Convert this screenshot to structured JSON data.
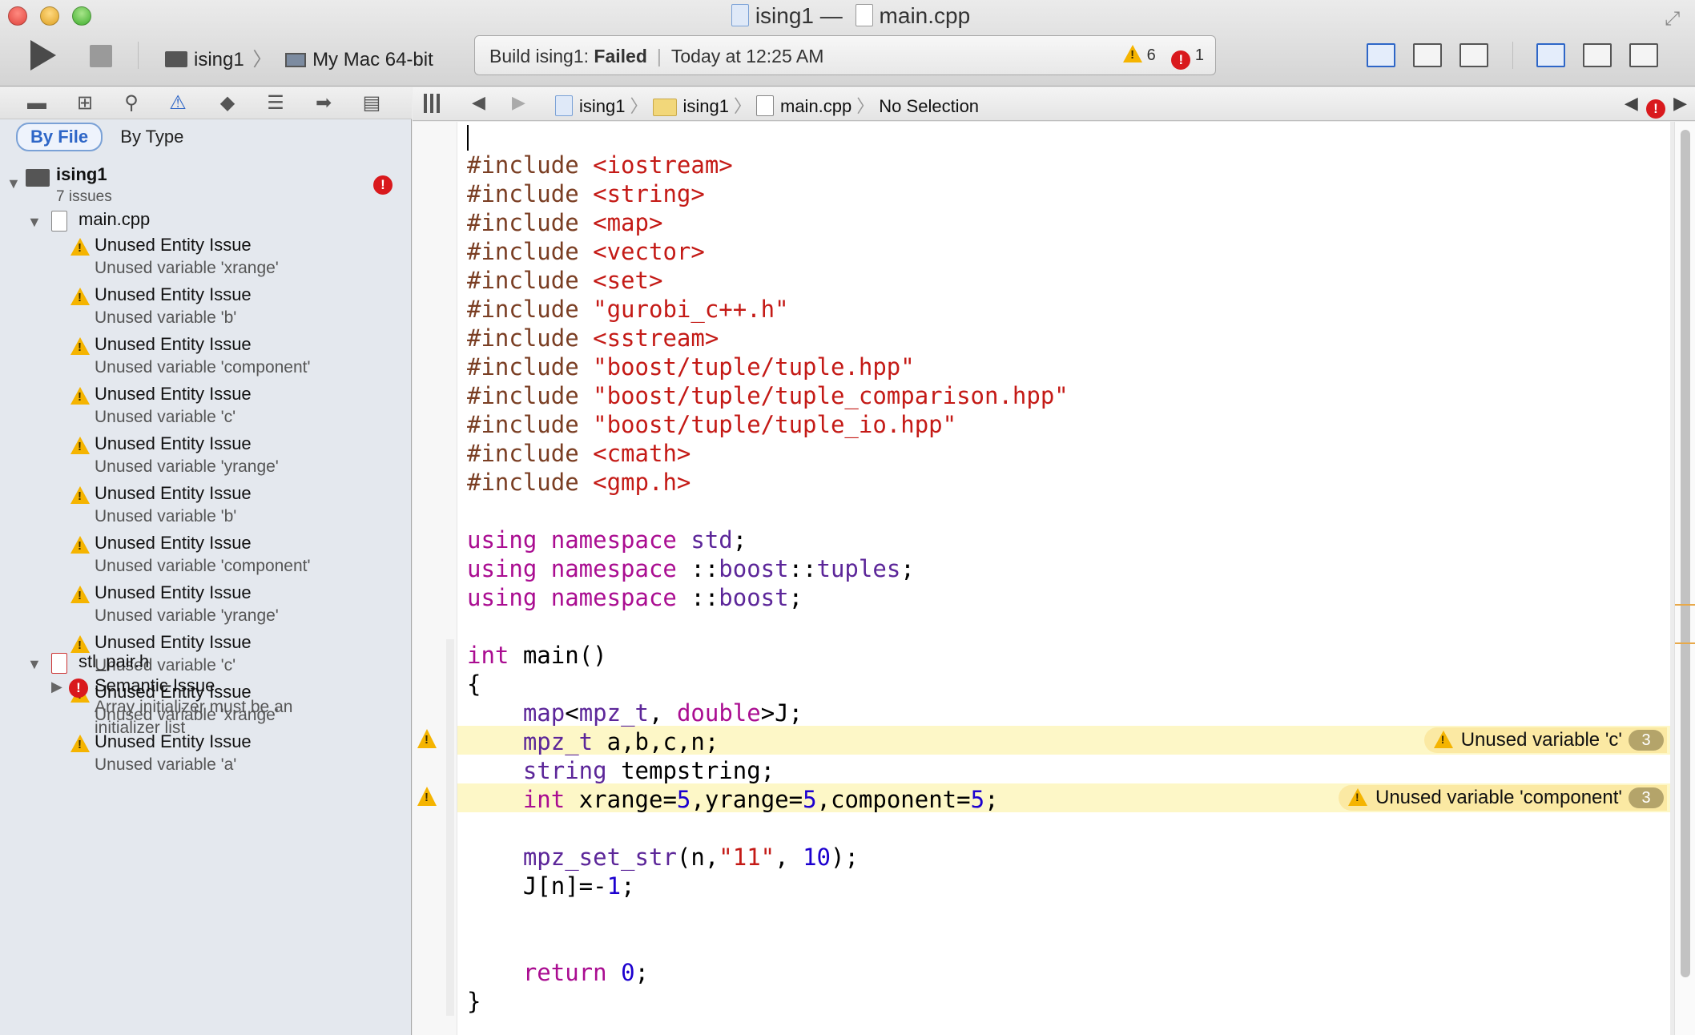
{
  "window": {
    "title_project": "ising1",
    "title_sep": "—",
    "title_file": "main.cpp"
  },
  "toolbar": {
    "scheme_project": "ising1",
    "scheme_chevron": "〉",
    "scheme_destination": "My Mac 64-bit",
    "activity_prefix": "Build ising1: ",
    "activity_status": "Failed",
    "activity_bar": "|",
    "activity_time": "Today at 12:25 AM",
    "warning_count": "6",
    "error_count": "1"
  },
  "navigator": {
    "filter_by_file": "By File",
    "filter_by_type": "By Type",
    "project_name": "ising1",
    "project_issue_count": "7 issues",
    "file1": "main.cpp",
    "file1_issues": [
      {
        "title": "Unused Entity Issue",
        "detail": "Unused variable 'xrange'"
      },
      {
        "title": "Unused Entity Issue",
        "detail": "Unused variable 'b'"
      },
      {
        "title": "Unused Entity Issue",
        "detail": "Unused variable 'component'"
      },
      {
        "title": "Unused Entity Issue",
        "detail": "Unused variable 'c'"
      },
      {
        "title": "Unused Entity Issue",
        "detail": "Unused variable 'yrange'"
      },
      {
        "title": "Unused Entity Issue",
        "detail": "Unused variable 'b'"
      },
      {
        "title": "Unused Entity Issue",
        "detail": "Unused variable 'component'"
      },
      {
        "title": "Unused Entity Issue",
        "detail": "Unused variable 'yrange'"
      },
      {
        "title": "Unused Entity Issue",
        "detail": "Unused variable 'c'"
      },
      {
        "title": "Unused Entity Issue",
        "detail": "Unused variable 'xrange'"
      },
      {
        "title": "Unused Entity Issue",
        "detail": "Unused variable 'a'"
      }
    ],
    "file2": "stl_pair.h",
    "file2_issue_title": "Semantic Issue",
    "file2_issue_detail_1": "Array initializer must be an",
    "file2_issue_detail_2": "initializer list"
  },
  "jumpbar": {
    "crumb_project": "ising1",
    "crumb_folder": "ising1",
    "crumb_file": "main.cpp",
    "crumb_symbol": "No Selection",
    "sep": "〉"
  },
  "editor": {
    "lines": [
      {
        "tokens": [
          {
            "c": "pp",
            "t": "#include "
          },
          {
            "c": "inc",
            "t": "<iostream>"
          }
        ]
      },
      {
        "tokens": [
          {
            "c": "pp",
            "t": "#include "
          },
          {
            "c": "inc",
            "t": "<string>"
          }
        ]
      },
      {
        "tokens": [
          {
            "c": "pp",
            "t": "#include "
          },
          {
            "c": "inc",
            "t": "<map>"
          }
        ]
      },
      {
        "tokens": [
          {
            "c": "pp",
            "t": "#include "
          },
          {
            "c": "inc",
            "t": "<vector>"
          }
        ]
      },
      {
        "tokens": [
          {
            "c": "pp",
            "t": "#include "
          },
          {
            "c": "inc",
            "t": "<set>"
          }
        ]
      },
      {
        "tokens": [
          {
            "c": "pp",
            "t": "#include "
          },
          {
            "c": "inc",
            "t": "\"gurobi_c++.h\""
          }
        ]
      },
      {
        "tokens": [
          {
            "c": "pp",
            "t": "#include "
          },
          {
            "c": "inc",
            "t": "<sstream>"
          }
        ]
      },
      {
        "tokens": [
          {
            "c": "pp",
            "t": "#include "
          },
          {
            "c": "inc",
            "t": "\"boost/tuple/tuple.hpp\""
          }
        ]
      },
      {
        "tokens": [
          {
            "c": "pp",
            "t": "#include "
          },
          {
            "c": "inc",
            "t": "\"boost/tuple/tuple_comparison.hpp\""
          }
        ]
      },
      {
        "tokens": [
          {
            "c": "pp",
            "t": "#include "
          },
          {
            "c": "inc",
            "t": "\"boost/tuple/tuple_io.hpp\""
          }
        ]
      },
      {
        "tokens": [
          {
            "c": "pp",
            "t": "#include "
          },
          {
            "c": "inc",
            "t": "<cmath>"
          }
        ]
      },
      {
        "tokens": [
          {
            "c": "pp",
            "t": "#include "
          },
          {
            "c": "inc",
            "t": "<gmp.h>"
          }
        ]
      },
      {
        "tokens": []
      },
      {
        "tokens": [
          {
            "c": "kw",
            "t": "using namespace "
          },
          {
            "c": "ty",
            "t": "std"
          },
          {
            "c": "",
            "t": ";"
          }
        ]
      },
      {
        "tokens": [
          {
            "c": "kw",
            "t": "using namespace "
          },
          {
            "c": "",
            "t": "::"
          },
          {
            "c": "ty",
            "t": "boost"
          },
          {
            "c": "",
            "t": "::"
          },
          {
            "c": "ty",
            "t": "tuples"
          },
          {
            "c": "",
            "t": ";"
          }
        ]
      },
      {
        "tokens": [
          {
            "c": "kw",
            "t": "using namespace "
          },
          {
            "c": "",
            "t": "::"
          },
          {
            "c": "ty",
            "t": "boost"
          },
          {
            "c": "",
            "t": ";"
          }
        ]
      },
      {
        "tokens": []
      },
      {
        "tokens": [
          {
            "c": "kw",
            "t": "int"
          },
          {
            "c": "",
            "t": " main()"
          }
        ]
      },
      {
        "tokens": [
          {
            "c": "",
            "t": "{"
          }
        ]
      },
      {
        "tokens": [
          {
            "c": "",
            "t": "    "
          },
          {
            "c": "ty",
            "t": "map"
          },
          {
            "c": "",
            "t": "<"
          },
          {
            "c": "ty",
            "t": "mpz_t"
          },
          {
            "c": "",
            "t": ", "
          },
          {
            "c": "kw",
            "t": "double"
          },
          {
            "c": "",
            "t": ">J;"
          }
        ]
      },
      {
        "tokens": [
          {
            "c": "",
            "t": "    "
          },
          {
            "c": "ty",
            "t": "mpz_t"
          },
          {
            "c": "",
            "t": " a,b,c,n;"
          }
        ]
      },
      {
        "tokens": [
          {
            "c": "",
            "t": "    "
          },
          {
            "c": "ty",
            "t": "string"
          },
          {
            "c": "",
            "t": " tempstring;"
          }
        ]
      },
      {
        "tokens": [
          {
            "c": "",
            "t": "    "
          },
          {
            "c": "kw",
            "t": "int"
          },
          {
            "c": "",
            "t": " xrange="
          },
          {
            "c": "num",
            "t": "5"
          },
          {
            "c": "",
            "t": ",yrange="
          },
          {
            "c": "num",
            "t": "5"
          },
          {
            "c": "",
            "t": ",component="
          },
          {
            "c": "num",
            "t": "5"
          },
          {
            "c": "",
            "t": ";"
          }
        ]
      },
      {
        "tokens": []
      },
      {
        "tokens": [
          {
            "c": "",
            "t": "    "
          },
          {
            "c": "ty",
            "t": "mpz_set_str"
          },
          {
            "c": "",
            "t": "(n,"
          },
          {
            "c": "str",
            "t": "\"11\""
          },
          {
            "c": "",
            "t": ", "
          },
          {
            "c": "num",
            "t": "10"
          },
          {
            "c": "",
            "t": ");"
          }
        ]
      },
      {
        "tokens": [
          {
            "c": "",
            "t": "    J[n]=-"
          },
          {
            "c": "num",
            "t": "1"
          },
          {
            "c": "",
            "t": ";"
          }
        ]
      },
      {
        "tokens": []
      },
      {
        "tokens": []
      },
      {
        "tokens": [
          {
            "c": "",
            "t": "    "
          },
          {
            "c": "kw",
            "t": "return"
          },
          {
            "c": "",
            "t": " "
          },
          {
            "c": "num",
            "t": "0"
          },
          {
            "c": "",
            "t": ";"
          }
        ]
      },
      {
        "tokens": [
          {
            "c": "",
            "t": "}"
          }
        ]
      }
    ],
    "warning_bubble_1": "Unused variable 'c'",
    "warning_bubble_1_count": "3",
    "warning_bubble_2": "Unused variable 'component'",
    "warning_bubble_2_count": "3"
  },
  "icons": {
    "folder": "folder-icon",
    "hierarchy": "hierarchy-icon",
    "search": "magnifier-icon",
    "issues": "warning-icon",
    "tests": "diamond-icon",
    "debug": "list-icon",
    "breakpoints": "breakpoint-icon",
    "log": "log-icon"
  },
  "colors": {
    "accent": "#2e66c7",
    "warning": "#f5b400",
    "error": "#d9191d",
    "highlight": "#fdf7c7"
  }
}
